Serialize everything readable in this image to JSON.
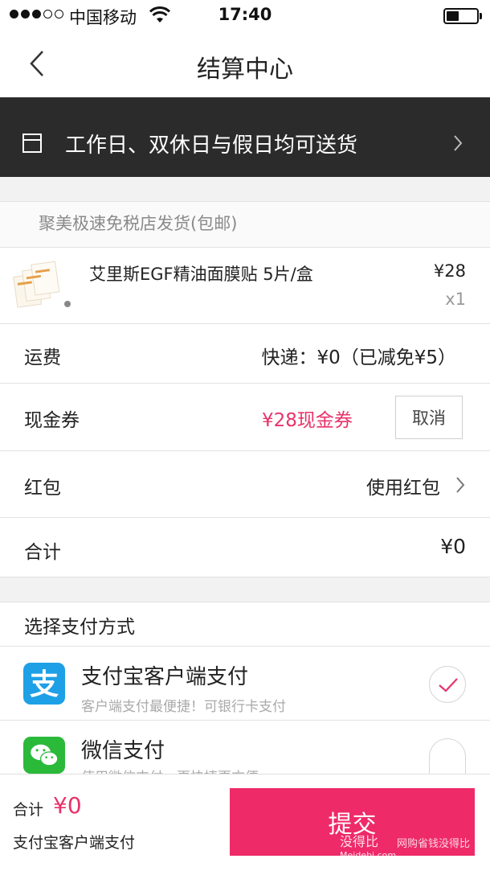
{
  "status_bar": {
    "carrier": "中国移动",
    "time": "17:40"
  },
  "nav": {
    "title": "结算中心"
  },
  "delivery": {
    "text": "工作日、双休日与假日均可送货"
  },
  "store": {
    "name": "聚美极速免税店发货(包邮)"
  },
  "product": {
    "name": "艾里斯EGF精油面膜贴 5片/盒",
    "price": "¥28",
    "qty": "x1"
  },
  "shipping": {
    "label": "运费",
    "value": "快递：¥0（已减免¥5）"
  },
  "coupon": {
    "label": "现金券",
    "value": "¥28现金券",
    "cancel": "取消"
  },
  "red_packet": {
    "label": "红包",
    "value": "使用红包"
  },
  "subtotal": {
    "label": "合计",
    "value": "¥0"
  },
  "payment": {
    "section_title": "选择支付方式",
    "options": [
      {
        "name": "支付宝客户端支付",
        "desc": "客户端支付最便捷！可银行卡支付",
        "selected": true,
        "icon": "alipay-icon"
      },
      {
        "name": "微信支付",
        "desc": "使用微信支付，更快捷更方便",
        "selected": false,
        "icon": "wechat-icon"
      }
    ]
  },
  "footer": {
    "total_label": "合计",
    "total_value": "¥0",
    "method": "支付宝客户端支付",
    "submit": "提交"
  },
  "watermark": {
    "brand": "没得比",
    "domain": "Meidebi.com",
    "slogan": "网购省钱没得比"
  },
  "colors": {
    "accent": "#ee2a68",
    "coupon": "#e8336b",
    "banner": "#2b2b2b",
    "alipay": "#1ea0e6",
    "wechat": "#2bb93a"
  }
}
